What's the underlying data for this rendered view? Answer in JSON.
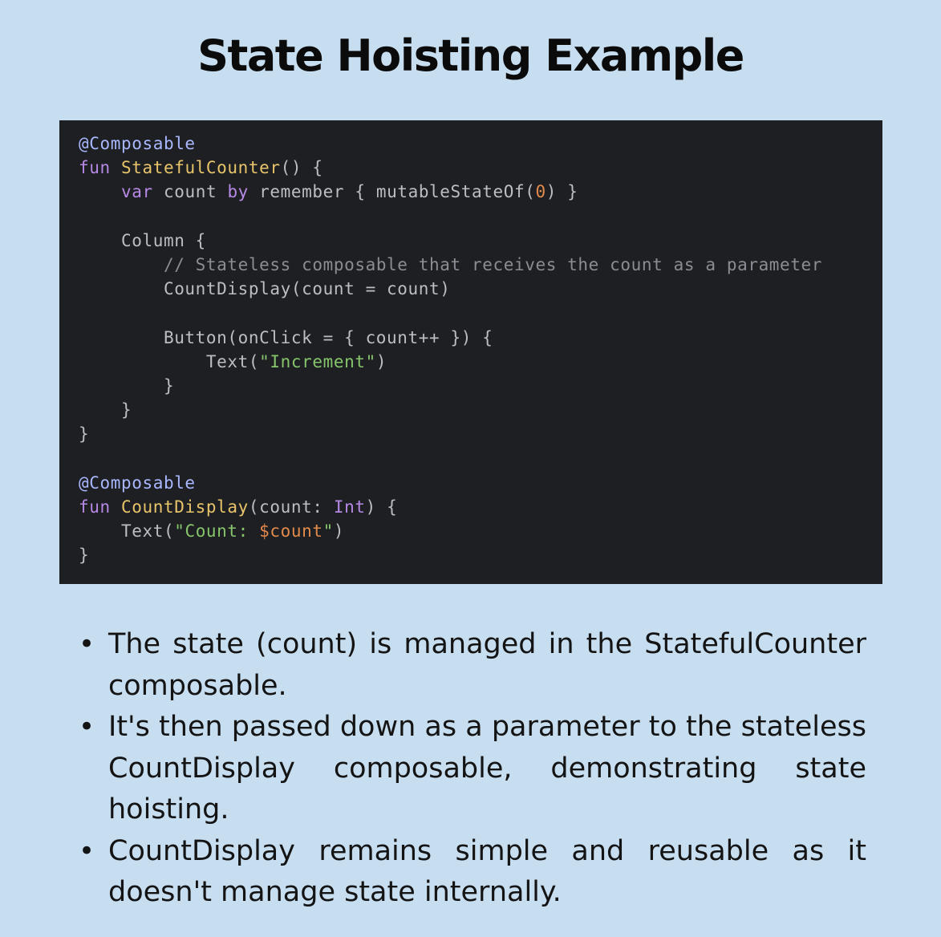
{
  "title": "State Hoisting Example",
  "code": {
    "lines": [
      [
        {
          "t": "@Composable",
          "c": "ann"
        }
      ],
      [
        {
          "t": "fun ",
          "c": "kw"
        },
        {
          "t": "StatefulCounter",
          "c": "fn"
        },
        {
          "t": "() {",
          "c": ""
        }
      ],
      [
        {
          "t": "    ",
          "c": ""
        },
        {
          "t": "var ",
          "c": "kw"
        },
        {
          "t": "count ",
          "c": ""
        },
        {
          "t": "by ",
          "c": "kw"
        },
        {
          "t": "remember { mutableStateOf(",
          "c": ""
        },
        {
          "t": "0",
          "c": "num"
        },
        {
          "t": ") }",
          "c": ""
        }
      ],
      [],
      [
        {
          "t": "    Column {",
          "c": ""
        }
      ],
      [
        {
          "t": "        ",
          "c": ""
        },
        {
          "t": "// Stateless composable that receives the count as a parameter",
          "c": "cm"
        }
      ],
      [
        {
          "t": "        CountDisplay(count = count)",
          "c": ""
        }
      ],
      [],
      [
        {
          "t": "        Button(onClick = { count++ }) {",
          "c": ""
        }
      ],
      [
        {
          "t": "            Text(",
          "c": ""
        },
        {
          "t": "\"Increment\"",
          "c": "str"
        },
        {
          "t": ")",
          "c": ""
        }
      ],
      [
        {
          "t": "        }",
          "c": ""
        }
      ],
      [
        {
          "t": "    }",
          "c": ""
        }
      ],
      [
        {
          "t": "}",
          "c": ""
        }
      ],
      [],
      [
        {
          "t": "@Composable",
          "c": "ann"
        }
      ],
      [
        {
          "t": "fun ",
          "c": "kw"
        },
        {
          "t": "CountDisplay",
          "c": "fn"
        },
        {
          "t": "(count: ",
          "c": ""
        },
        {
          "t": "Int",
          "c": "tp"
        },
        {
          "t": ") {",
          "c": ""
        }
      ],
      [
        {
          "t": "    Text(",
          "c": ""
        },
        {
          "t": "\"Count: ",
          "c": "str"
        },
        {
          "t": "$count",
          "c": "tpl"
        },
        {
          "t": "\"",
          "c": "str"
        },
        {
          "t": ")",
          "c": ""
        }
      ],
      [
        {
          "t": "}",
          "c": ""
        }
      ]
    ]
  },
  "bullets": [
    "The state (count) is managed in the StatefulCounter composable.",
    "It's then passed down as a parameter to the stateless CountDisplay composable, demonstrating state hoisting.",
    "CountDisplay remains simple and reusable as it doesn't manage state internally."
  ]
}
